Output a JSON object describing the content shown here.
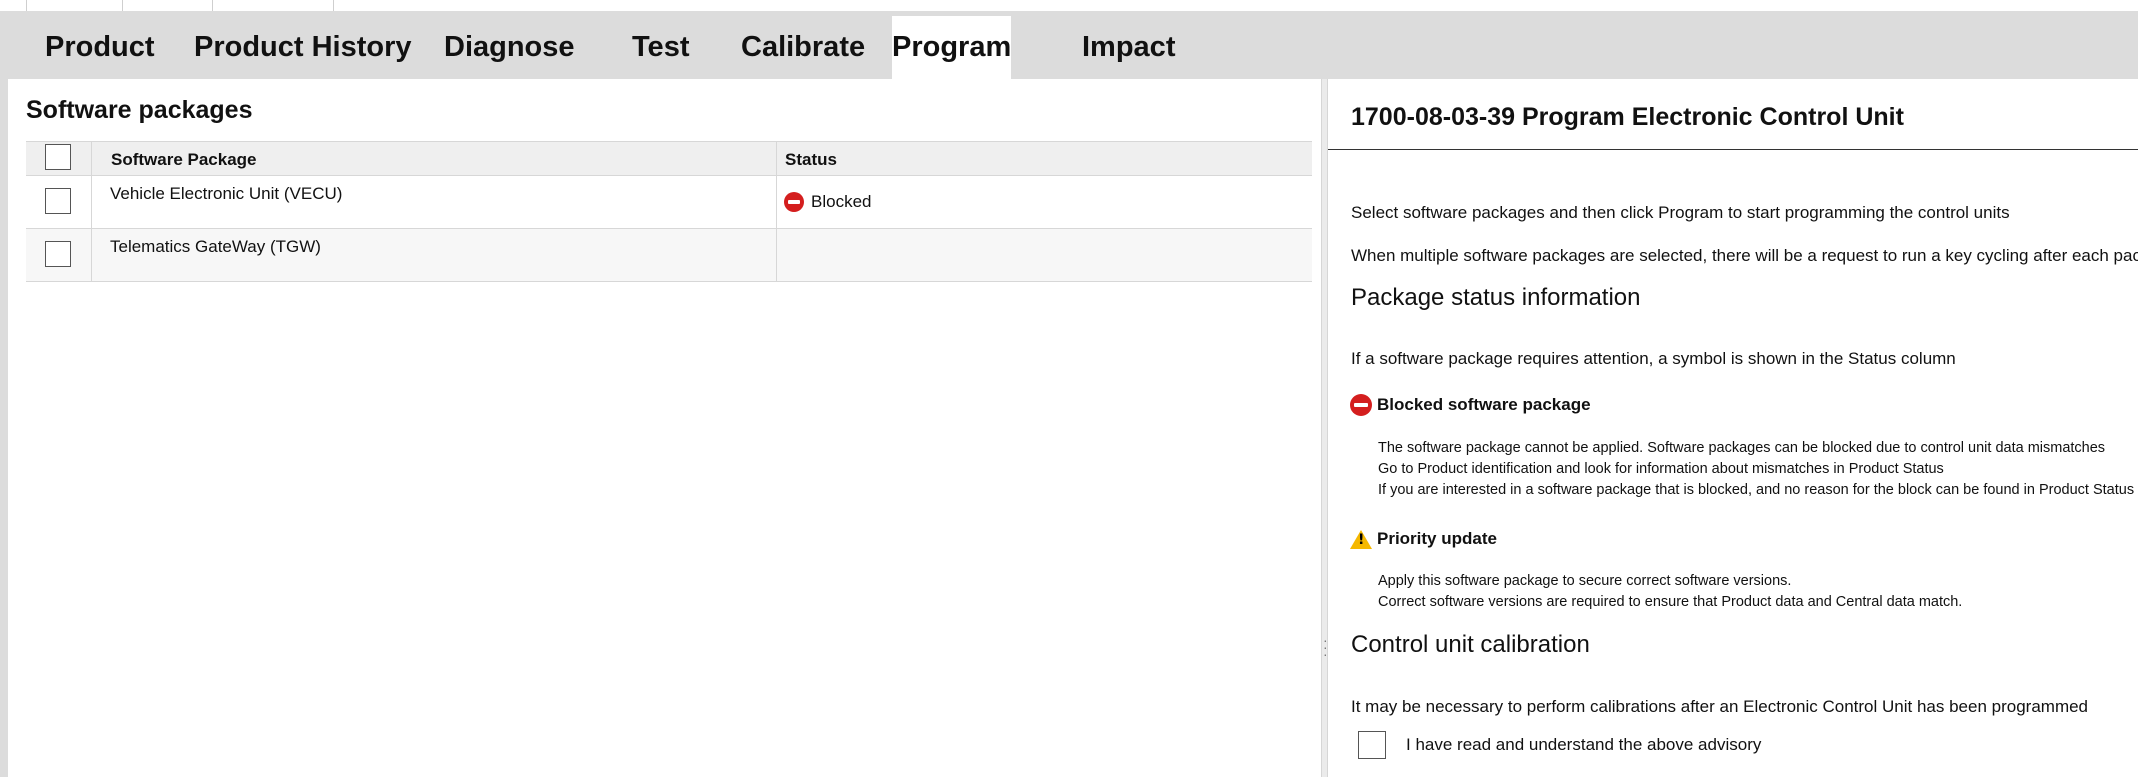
{
  "tabs": [
    {
      "label": "Product",
      "active": false
    },
    {
      "label": "Product History",
      "active": false
    },
    {
      "label": "Diagnose",
      "active": false
    },
    {
      "label": "Test",
      "active": false
    },
    {
      "label": "Calibrate",
      "active": false
    },
    {
      "label": "Program",
      "active": true
    },
    {
      "label": "Impact",
      "active": false
    }
  ],
  "left": {
    "title": "Software packages",
    "columns": [
      "Software Package",
      "Status"
    ],
    "rows": [
      {
        "name": "Vehicle Electronic Unit (VECU)",
        "status": "Blocked"
      },
      {
        "name": "Telematics GateWay (TGW)",
        "status": ""
      }
    ]
  },
  "right": {
    "title": "1700-08-03-39 Program Electronic Control Unit",
    "intro1": "Select software packages and then click Program to start programming the control units",
    "intro2": "When multiple software packages are selected, there will be a request to run a key cycling after each package",
    "status_heading": "Package status information",
    "status_intro": "If a software package requires attention, a symbol is shown in the Status column",
    "blocked_heading": "Blocked software package",
    "blocked_lines": [
      "The software package cannot be applied. Software packages can be blocked due to control unit data mismatches",
      "Go to Product identification and look for information about mismatches in Product Status",
      "If you are interested in a software package that is blocked, and no reason for the block can be found in Product Status"
    ],
    "priority_heading": "Priority update",
    "priority_lines": [
      "Apply this software package to secure correct software versions.",
      "Correct software versions are required to ensure that Product data and Central data match."
    ],
    "calib_heading": "Control unit calibration",
    "calib_text": "It may be necessary to perform calibrations after an Electronic Control Unit has been programmed",
    "ack_label": "I have read and understand the above advisory"
  },
  "colors": {
    "blocked": "#d41e1e",
    "warning": "#f5b800",
    "tabbar": "#dcdcdc"
  }
}
